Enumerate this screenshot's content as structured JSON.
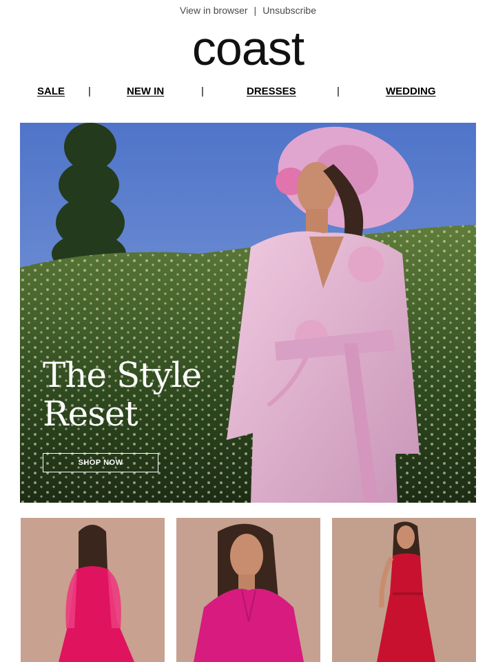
{
  "topbar": {
    "view_in_browser": "View in browser",
    "separator": "|",
    "unsubscribe": "Unsubscribe"
  },
  "brand": {
    "logo": "coast"
  },
  "nav": {
    "items": [
      "SALE",
      "NEW IN",
      "DRESSES",
      "WEDDING"
    ],
    "separator": "|"
  },
  "hero": {
    "title_line1": "The Style",
    "title_line2": "Reset",
    "cta": "SHOP NOW"
  },
  "products": [
    {
      "name": "pink-chiffon-dress",
      "color": "#e0135f"
    },
    {
      "name": "pink-satin-shirt",
      "color": "#d81b7e"
    },
    {
      "name": "red-midi-dress",
      "color": "#c8112f"
    }
  ],
  "colors": {
    "text": "#000000",
    "muted": "#4a4a4a",
    "hero_sky": "#5a7fcf",
    "hedge": "#4a6a2a",
    "jacket": "#e6b8d4",
    "product_bg": "#c9a190"
  }
}
